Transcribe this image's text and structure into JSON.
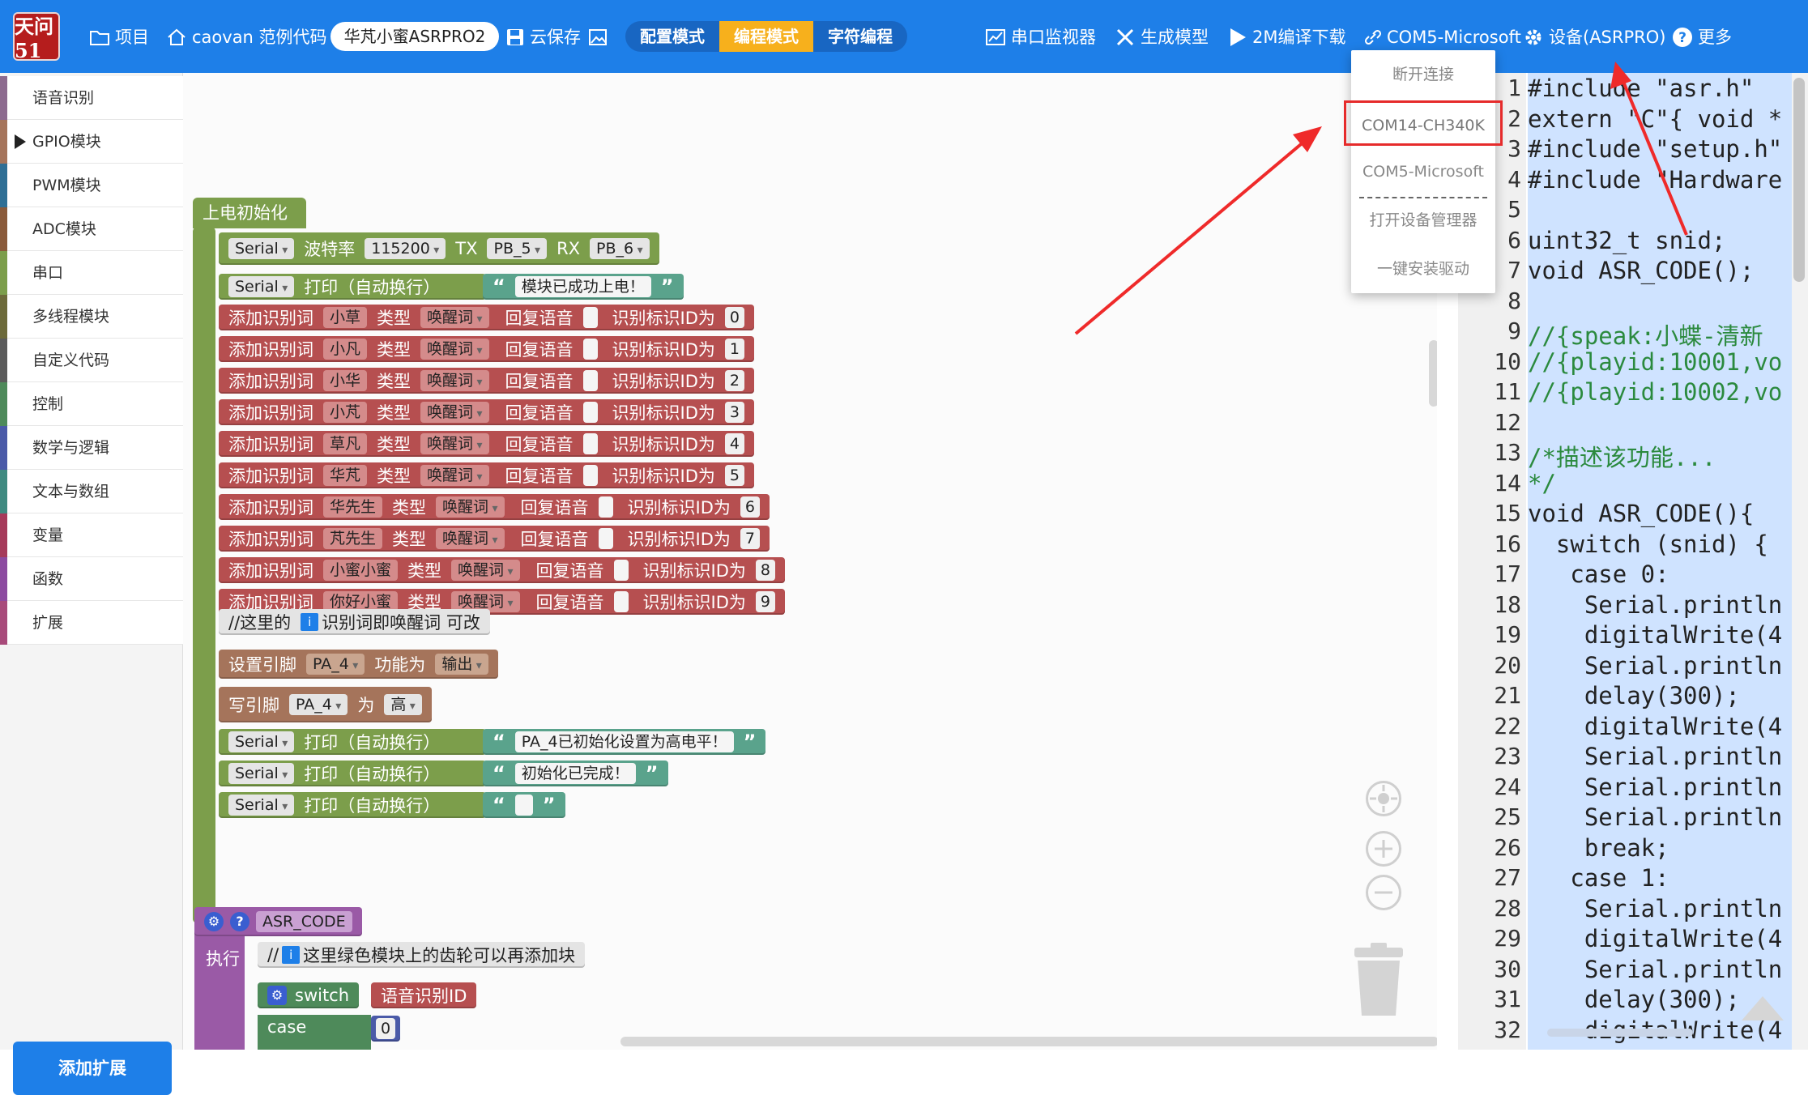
{
  "topbar": {
    "logo_text": "天问51",
    "project": "项目",
    "user_example": "caovan 范例代码",
    "device_name": "华芃小蜜ASRPRO2",
    "cloud_save": "云保存",
    "modes": [
      "配置模式",
      "编程模式",
      "字符编程"
    ],
    "active_mode": "编程模式",
    "serial_monitor": "串口监视器",
    "gen_model": "生成模型",
    "compile_download": "2M编译下载",
    "port": "COM5-Microsoft",
    "device_settings": "设备(ASRPRO)",
    "more": "更多"
  },
  "dropdown": {
    "items": [
      "断开连接",
      "COM14-CH340K",
      "COM5-Microsoft",
      "打开设备管理器",
      "一键安装驱动"
    ],
    "highlighted": "COM14-CH340K"
  },
  "sidebar": {
    "items": [
      {
        "label": "语音识别",
        "color": "#8d6b8f"
      },
      {
        "label": "GPIO模块",
        "color": "#a5745b"
      },
      {
        "label": "PWM模块",
        "color": "#2f6f95"
      },
      {
        "label": "ADC模块",
        "color": "#8a5a3a"
      },
      {
        "label": "串口",
        "color": "#7c9e4b"
      },
      {
        "label": "多线程模块",
        "color": "#6d6a3a"
      },
      {
        "label": "自定义代码",
        "color": "#5b5b5b"
      },
      {
        "label": "控制",
        "color": "#4e8a5a"
      },
      {
        "label": "数学与逻辑",
        "color": "#4a5aa8"
      },
      {
        "label": "文本与数组",
        "color": "#3f8a80"
      },
      {
        "label": "变量",
        "color": "#a63a5a"
      },
      {
        "label": "函数",
        "color": "#8c4aa0"
      },
      {
        "label": "扩展",
        "color": "#a84a7a"
      }
    ],
    "add_extension": "添加扩展"
  },
  "blocks": {
    "setup_hat": "上电初始化",
    "serial_begin": {
      "serial": "Serial",
      "baud_label": "波特率",
      "baud": "115200",
      "tx_label": "TX",
      "tx": "PB_5",
      "rx_label": "RX",
      "rx": "PB_6"
    },
    "print_label": "打印（自动换行）",
    "print1": "模块已成功上电！",
    "rec_add": "添加识别词",
    "rec_type": "类型",
    "rec_wake": "唤醒词",
    "rec_reply": "回复语音",
    "rec_id": "识别标识ID为",
    "words": [
      {
        "word": "小草",
        "id": "0"
      },
      {
        "word": "小凡",
        "id": "1"
      },
      {
        "word": "小华",
        "id": "2"
      },
      {
        "word": "小芃",
        "id": "3"
      },
      {
        "word": "草凡",
        "id": "4"
      },
      {
        "word": "华芃",
        "id": "5"
      },
      {
        "word": "华先生",
        "id": "6"
      },
      {
        "word": "芃先生",
        "id": "7"
      },
      {
        "word": "小蜜小蜜",
        "id": "8"
      },
      {
        "word": "你好小蜜",
        "id": "9"
      }
    ],
    "comment1_pre": "//这里的",
    "comment1_post": "识别词即唤醒词 可改",
    "set_pin": "设置引脚",
    "pin": "PA_4",
    "func_label": "功能为",
    "func": "输出",
    "write_pin": "写引脚",
    "write_as": "为",
    "level": "高",
    "print2": "PA_4已初始化设置为高电平！",
    "print3": "初始化已完成！",
    "print4": "",
    "asr_func": "ASR_CODE",
    "exec_label": "执行",
    "comment2": "这里绿色模块上的齿轮可以再添加块",
    "switch_label": "switch",
    "switch_val": "语音识别ID",
    "case_label": "case",
    "case_val": "0"
  },
  "code": {
    "lines": [
      "#include \"asr.h\"",
      "extern \"C\"{ void *",
      "#include \"setup.h\"",
      "#include \"Hardware",
      "",
      "uint32_t snid;",
      "void ASR_CODE();",
      "",
      "//{speak:小蝶-清新",
      "//{playid:10001,vo",
      "//{playid:10002,vo",
      "",
      "/*描述该功能...",
      "*/",
      "void ASR_CODE(){",
      "  switch (snid) {",
      "   case 0:",
      "    Serial.println",
      "    digitalWrite(4",
      "    Serial.println",
      "    delay(300);",
      "    digitalWrite(4",
      "    Serial.println",
      "    Serial.println",
      "    Serial.println",
      "    break;",
      "   case 1:",
      "    Serial.println",
      "    digitalWrite(4",
      "    Serial.println",
      "    delay(300);",
      "    digitalWrite(4"
    ],
    "numbers": [
      "1",
      "2",
      "3",
      "4",
      "5",
      "6",
      "7",
      "8",
      "9",
      "10",
      "11",
      "12",
      "13",
      "14",
      "15",
      "16",
      "17",
      "18",
      "19",
      "20",
      "21",
      "22",
      "23",
      "24",
      "25",
      "26",
      "27",
      "28",
      "29",
      "30",
      "31",
      "32"
    ]
  },
  "colors": {
    "accent": "#1e7fe8",
    "active_mode": "#f7b01c",
    "highlight": "#e62b2b"
  }
}
